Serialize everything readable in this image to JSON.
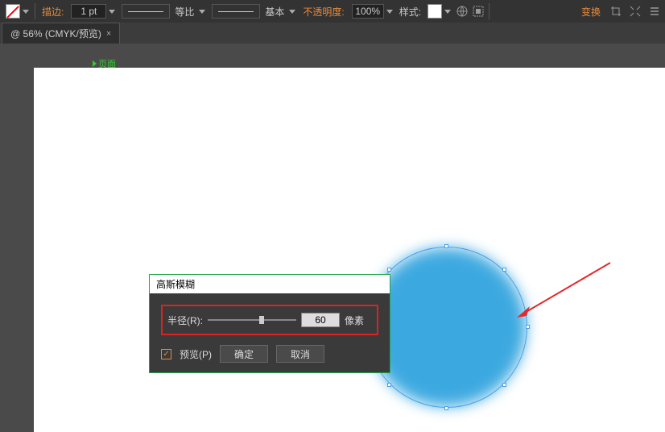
{
  "toolbar": {
    "stroke_label": "描边:",
    "stroke_weight": "1 pt",
    "dash_label": "等比",
    "profile_label": "基本",
    "opacity_label": "不透明度:",
    "opacity_value": "100%",
    "style_label": "样式:",
    "transform_label": "变换"
  },
  "tab": {
    "title": "@ 56% (CMYK/预览)",
    "close": "×"
  },
  "page_tag": "页面",
  "dialog": {
    "title": "高斯模糊",
    "radius_label": "半径(R):",
    "radius_value": "60",
    "unit": "像素",
    "preview_label": "预览(P)",
    "ok": "确定",
    "cancel": "取消"
  }
}
